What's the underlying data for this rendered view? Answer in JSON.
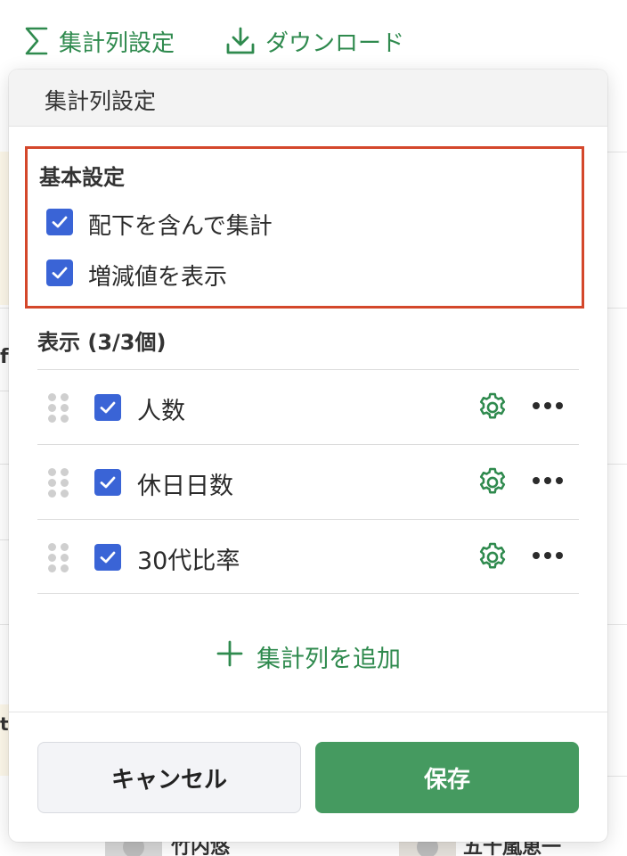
{
  "toolbar": {
    "summary_label": "集計列設定",
    "download_label": "ダウンロード"
  },
  "background": {
    "fragment_f": "f",
    "fragment_t": "t",
    "persons": [
      "竹内悠",
      "五十嵐恵一"
    ]
  },
  "popover": {
    "title": "集計列設定",
    "basic": {
      "title": "基本設定",
      "options": [
        {
          "label": "配下を含んで集計",
          "checked": true
        },
        {
          "label": "増減値を表示",
          "checked": true
        }
      ]
    },
    "display": {
      "title": "表示 (3/3個)",
      "items": [
        {
          "label": "人数",
          "checked": true
        },
        {
          "label": "休日日数",
          "checked": true
        },
        {
          "label": "30代比率",
          "checked": true
        }
      ]
    },
    "add_label": "集計列を追加",
    "cancel_label": "キャンセル",
    "save_label": "保存"
  },
  "colors": {
    "accent_green": "#2f8a4e",
    "save_green": "#459a60",
    "checkbox_blue": "#3a64d6",
    "highlight_red": "#d4472b"
  }
}
